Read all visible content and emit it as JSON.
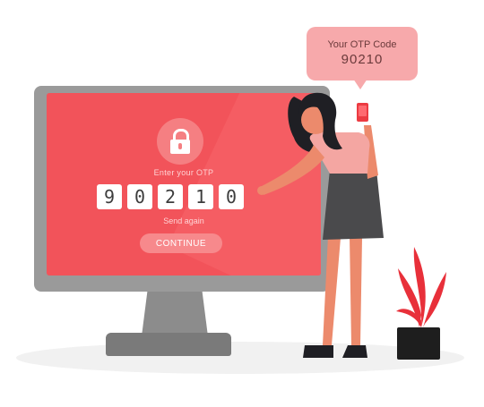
{
  "otp_screen": {
    "prompt": "Enter your OTP",
    "digits": [
      "9",
      "0",
      "2",
      "1",
      "0"
    ],
    "send_again": "Send again",
    "continue_label": "CONTINUE"
  },
  "message_bubble": {
    "title": "Your OTP Code",
    "code": "90210"
  },
  "colors": {
    "screen": "#f2535a",
    "accent_pink": "#f7a9ab",
    "monitor_frame": "#9a9a9a",
    "plant": "#e8303a"
  },
  "icons": [
    "lock-icon",
    "phone-icon",
    "plant-icon"
  ]
}
